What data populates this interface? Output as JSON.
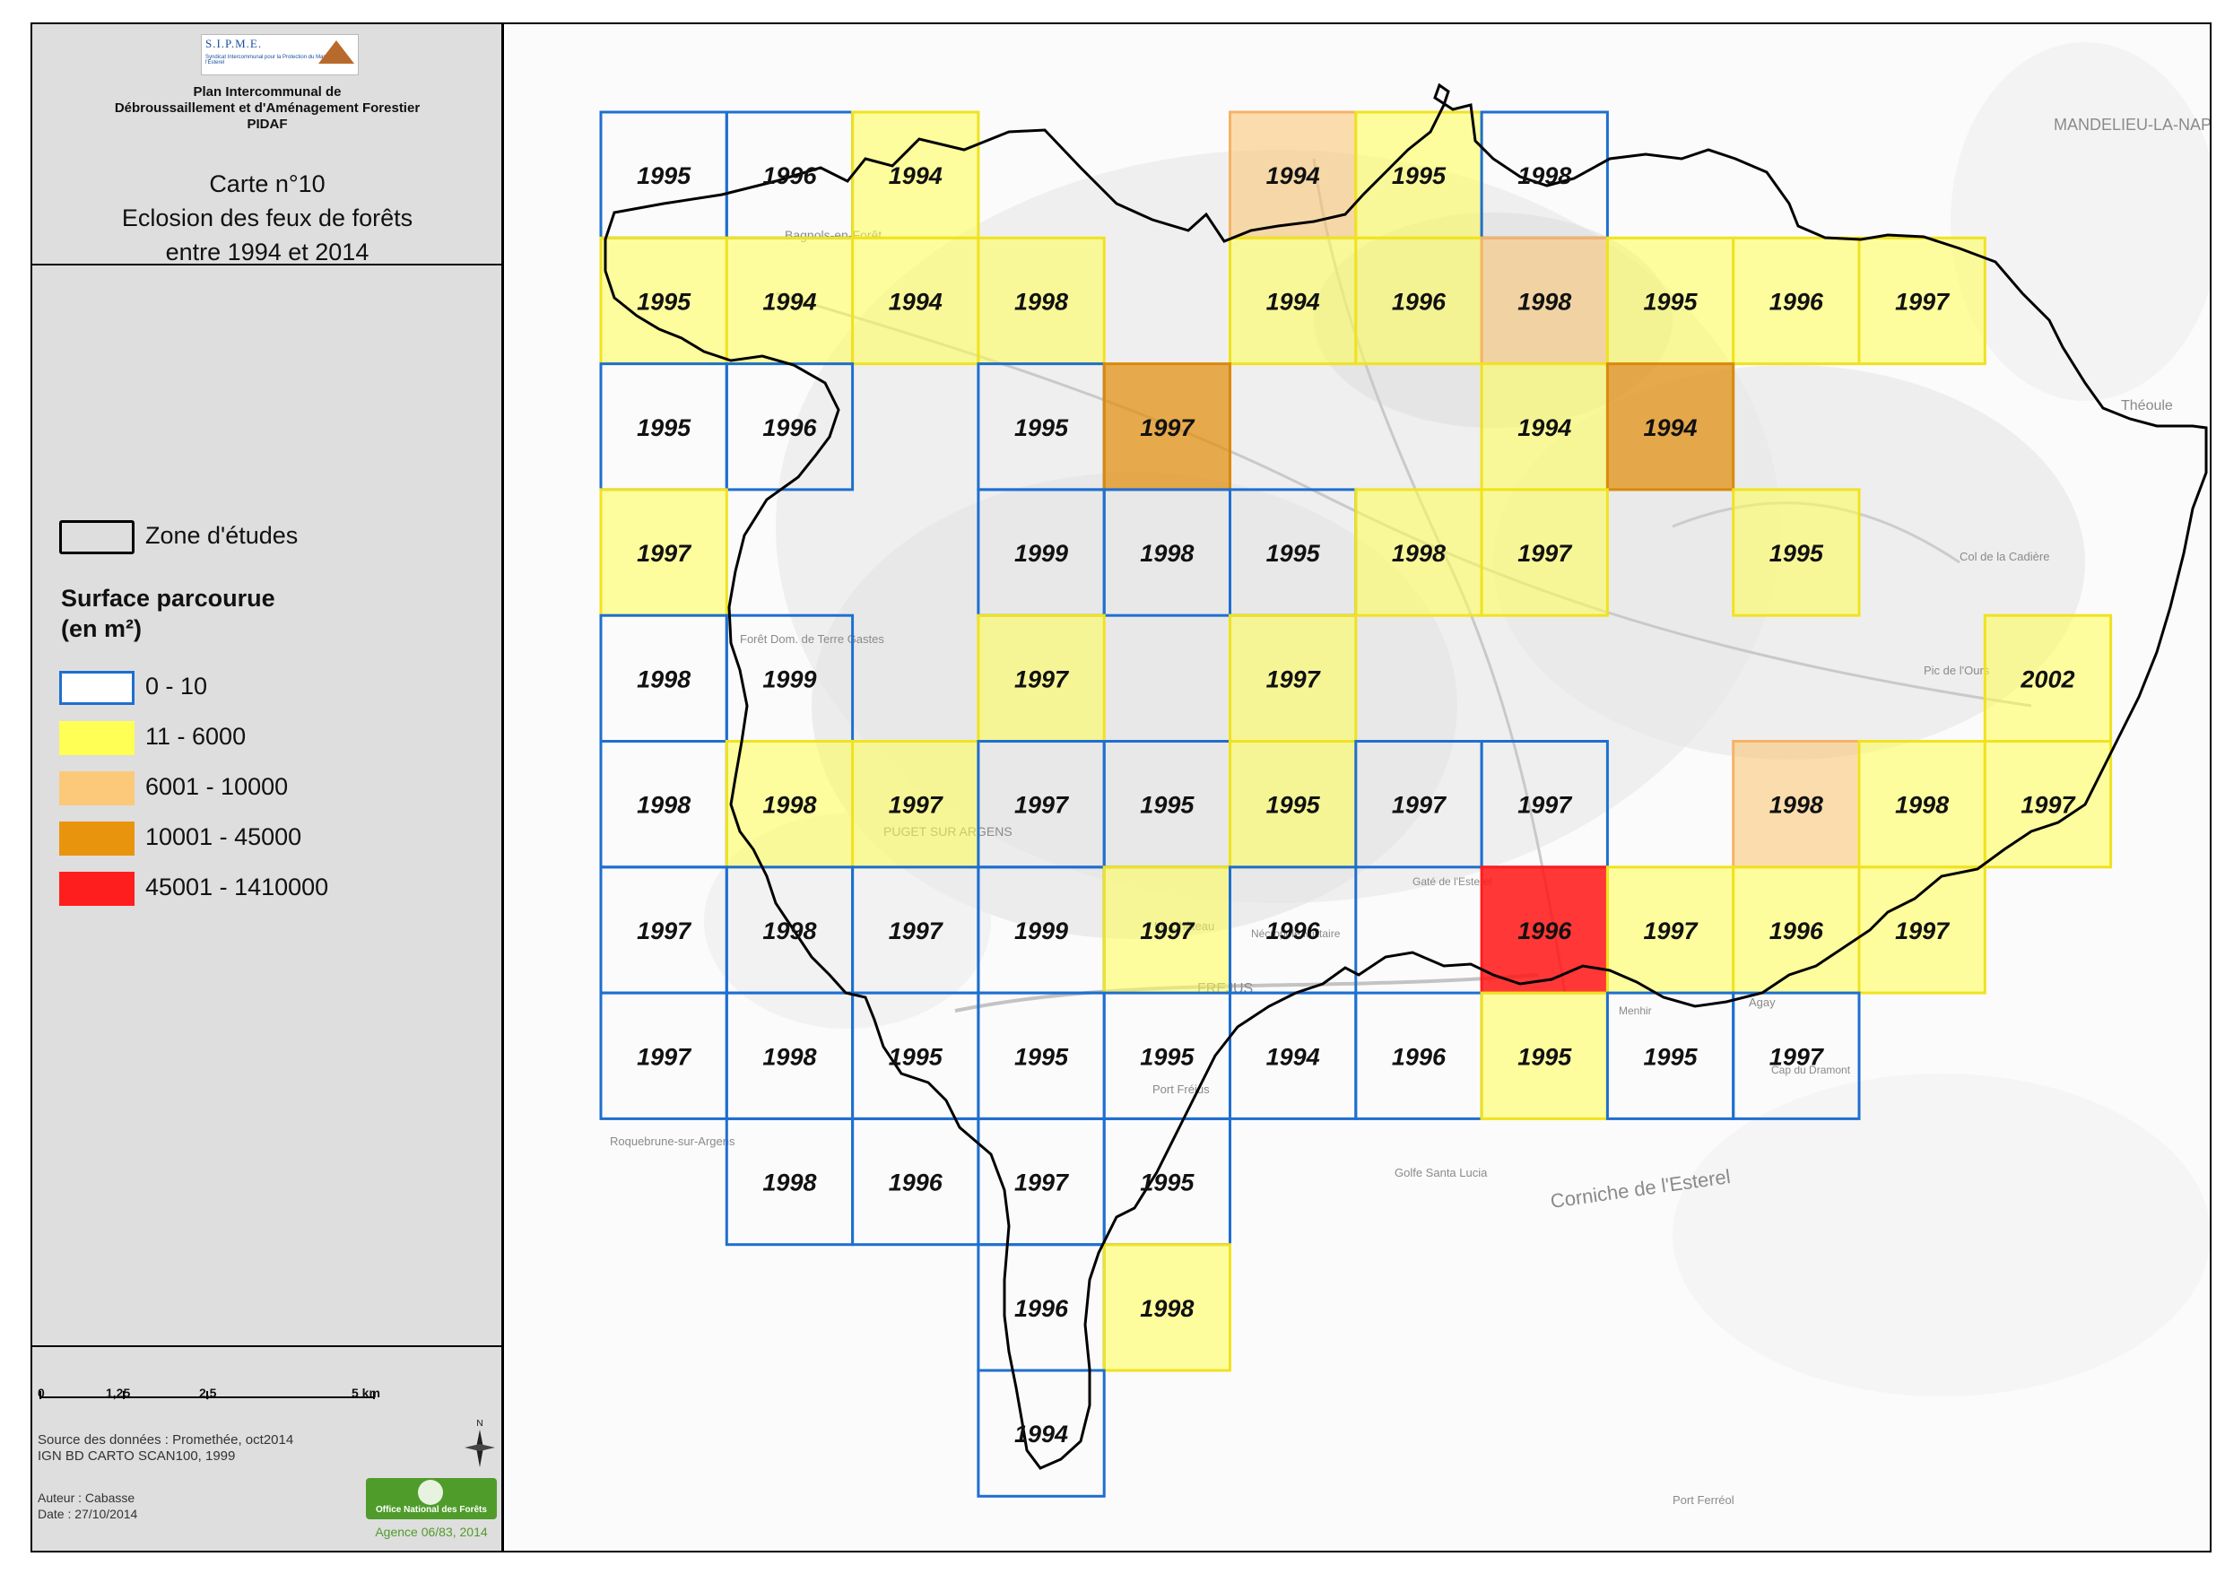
{
  "header": {
    "logo_text": "S.I.P.M.E.",
    "logo_subtitle": "Syndicat Intercommunal pour la Protection du Massif de l'Esterel",
    "plan_line1": "Plan Intercommunal de",
    "plan_line2": "Débroussaillement et d'Aménagement Forestier",
    "plan_line3": "PIDAF",
    "map_no": "Carte n°10",
    "title_line1": "Eclosion des feux de forêts",
    "title_line2": "entre 1994 et 2014"
  },
  "legend": {
    "zone_label": "Zone d'études",
    "heading_line1": "Surface parcourue",
    "heading_line2": "(en m²)",
    "classes": [
      {
        "label": "0 - 10",
        "color": "#1e6fd0",
        "kind": "outline"
      },
      {
        "label": "11 - 6000",
        "color": "#ffff55",
        "kind": "fill"
      },
      {
        "label": "6001 - 10000",
        "color": "#fcc97a",
        "kind": "fill"
      },
      {
        "label": "10001 - 45000",
        "color": "#e8950d",
        "kind": "fill"
      },
      {
        "label": "45001 - 1410000",
        "color": "#ff1e1e",
        "kind": "fill"
      }
    ]
  },
  "scale": {
    "labels": [
      "0",
      "1,25",
      "2,5",
      "5 km"
    ]
  },
  "north_label": "N",
  "source": {
    "line1": "Source des données : Promethée, oct2014",
    "line2": "IGN BD CARTO SCAN100, 1999"
  },
  "author": {
    "line1": "Auteur : Cabasse",
    "line2": "Date : 27/10/2014"
  },
  "onf": {
    "name": "Office National des Forêts",
    "agence": "Agence 06/83, 2014"
  },
  "map": {
    "place_names": [
      "MANDELIEU-LA-NAPOULE",
      "Théoule",
      "Corniche de l'Esterel",
      "Bagnols-en-Forêt",
      "FREJUS",
      "Port Fréjus",
      "Menhir",
      "Agay",
      "Pic de l'Ours",
      "Col de la Cadière",
      "Forêt Dom. de Terre Gastes",
      "Roquebrune-sur-Argens",
      "Golfe Santa Lucia",
      "Port Ferréol",
      "PUGET SUR ARGENS",
      "Le Château",
      "Nécropole Militaire",
      "Gaté de l'Esterel",
      "Cap du Dramont"
    ],
    "cells": [
      {
        "col": 0,
        "row": 0,
        "year": "1995",
        "cls": 0
      },
      {
        "col": 1,
        "row": 0,
        "year": "1996",
        "cls": 0
      },
      {
        "col": 2,
        "row": 0,
        "year": "1994",
        "cls": 1
      },
      {
        "col": 5,
        "row": 0,
        "year": "1994",
        "cls": 2
      },
      {
        "col": 6,
        "row": 0,
        "year": "1995",
        "cls": 1
      },
      {
        "col": 7,
        "row": 0,
        "year": "1998",
        "cls": 0
      },
      {
        "col": 0,
        "row": 1,
        "year": "1995",
        "cls": 1
      },
      {
        "col": 1,
        "row": 1,
        "year": "1994",
        "cls": 1
      },
      {
        "col": 2,
        "row": 1,
        "year": "1994",
        "cls": 1
      },
      {
        "col": 3,
        "row": 1,
        "year": "1998",
        "cls": 1
      },
      {
        "col": 5,
        "row": 1,
        "year": "1994",
        "cls": 1
      },
      {
        "col": 6,
        "row": 1,
        "year": "1996",
        "cls": 1
      },
      {
        "col": 7,
        "row": 1,
        "year": "1998",
        "cls": 2
      },
      {
        "col": 8,
        "row": 1,
        "year": "1995",
        "cls": 1
      },
      {
        "col": 9,
        "row": 1,
        "year": "1996",
        "cls": 1
      },
      {
        "col": 10,
        "row": 1,
        "year": "1997",
        "cls": 1
      },
      {
        "col": 0,
        "row": 2,
        "year": "1995",
        "cls": 0
      },
      {
        "col": 1,
        "row": 2,
        "year": "1996",
        "cls": 0
      },
      {
        "col": 3,
        "row": 2,
        "year": "1995",
        "cls": 0
      },
      {
        "col": 4,
        "row": 2,
        "year": "1997",
        "cls": 3
      },
      {
        "col": 7,
        "row": 2,
        "year": "1994",
        "cls": 1
      },
      {
        "col": 8,
        "row": 2,
        "year": "1994",
        "cls": 3
      },
      {
        "col": 0,
        "row": 3,
        "year": "1997",
        "cls": 1
      },
      {
        "col": 3,
        "row": 3,
        "year": "1999",
        "cls": 0
      },
      {
        "col": 4,
        "row": 3,
        "year": "1998",
        "cls": 0
      },
      {
        "col": 5,
        "row": 3,
        "year": "1995",
        "cls": 0
      },
      {
        "col": 6,
        "row": 3,
        "year": "1998",
        "cls": 1
      },
      {
        "col": 7,
        "row": 3,
        "year": "1997",
        "cls": 1
      },
      {
        "col": 9,
        "row": 3,
        "year": "1995",
        "cls": 1
      },
      {
        "col": 0,
        "row": 4,
        "year": "1998",
        "cls": 0
      },
      {
        "col": 1,
        "row": 4,
        "year": "1999",
        "cls": 0
      },
      {
        "col": 3,
        "row": 4,
        "year": "1997",
        "cls": 1
      },
      {
        "col": 5,
        "row": 4,
        "year": "1997",
        "cls": 1
      },
      {
        "col": 11,
        "row": 4,
        "year": "2002",
        "cls": 1
      },
      {
        "col": 0,
        "row": 5,
        "year": "1998",
        "cls": 0
      },
      {
        "col": 1,
        "row": 5,
        "year": "1998",
        "cls": 1
      },
      {
        "col": 2,
        "row": 5,
        "year": "1997",
        "cls": 1
      },
      {
        "col": 3,
        "row": 5,
        "year": "1997",
        "cls": 0
      },
      {
        "col": 4,
        "row": 5,
        "year": "1995",
        "cls": 0
      },
      {
        "col": 5,
        "row": 5,
        "year": "1995",
        "cls": 1
      },
      {
        "col": 6,
        "row": 5,
        "year": "1997",
        "cls": 0
      },
      {
        "col": 7,
        "row": 5,
        "year": "1997",
        "cls": 0
      },
      {
        "col": 9,
        "row": 5,
        "year": "1998",
        "cls": 2
      },
      {
        "col": 10,
        "row": 5,
        "year": "1998",
        "cls": 1
      },
      {
        "col": 11,
        "row": 5,
        "year": "1997",
        "cls": 1
      },
      {
        "col": 0,
        "row": 6,
        "year": "1997",
        "cls": 0
      },
      {
        "col": 1,
        "row": 6,
        "year": "1998",
        "cls": 0
      },
      {
        "col": 2,
        "row": 6,
        "year": "1997",
        "cls": 0
      },
      {
        "col": 3,
        "row": 6,
        "year": "1999",
        "cls": 0
      },
      {
        "col": 4,
        "row": 6,
        "year": "1997",
        "cls": 1
      },
      {
        "col": 5,
        "row": 6,
        "year": "1996",
        "cls": 0
      },
      {
        "col": 7,
        "row": 6,
        "year": "1996",
        "cls": 4
      },
      {
        "col": 8,
        "row": 6,
        "year": "1997",
        "cls": 1
      },
      {
        "col": 9,
        "row": 6,
        "year": "1996",
        "cls": 1
      },
      {
        "col": 10,
        "row": 6,
        "year": "1997",
        "cls": 1
      },
      {
        "col": 0,
        "row": 7,
        "year": "1997",
        "cls": 0
      },
      {
        "col": 1,
        "row": 7,
        "year": "1998",
        "cls": 0
      },
      {
        "col": 2,
        "row": 7,
        "year": "1995",
        "cls": 0
      },
      {
        "col": 3,
        "row": 7,
        "year": "1995",
        "cls": 0
      },
      {
        "col": 4,
        "row": 7,
        "year": "1995",
        "cls": 0
      },
      {
        "col": 5,
        "row": 7,
        "year": "1994",
        "cls": 0
      },
      {
        "col": 6,
        "row": 7,
        "year": "1996",
        "cls": 0
      },
      {
        "col": 7,
        "row": 7,
        "year": "1995",
        "cls": 1
      },
      {
        "col": 8,
        "row": 7,
        "year": "1995",
        "cls": 0
      },
      {
        "col": 9,
        "row": 7,
        "year": "1997",
        "cls": 0
      },
      {
        "col": 1,
        "row": 8,
        "year": "1998",
        "cls": 0
      },
      {
        "col": 2,
        "row": 8,
        "year": "1996",
        "cls": 0
      },
      {
        "col": 3,
        "row": 8,
        "year": "1997",
        "cls": 0
      },
      {
        "col": 4,
        "row": 8,
        "year": "1995",
        "cls": 0
      },
      {
        "col": 3,
        "row": 9,
        "year": "1996",
        "cls": 0
      },
      {
        "col": 4,
        "row": 9,
        "year": "1998",
        "cls": 1
      },
      {
        "col": 3,
        "row": 10,
        "year": "1994",
        "cls": 0
      }
    ]
  }
}
